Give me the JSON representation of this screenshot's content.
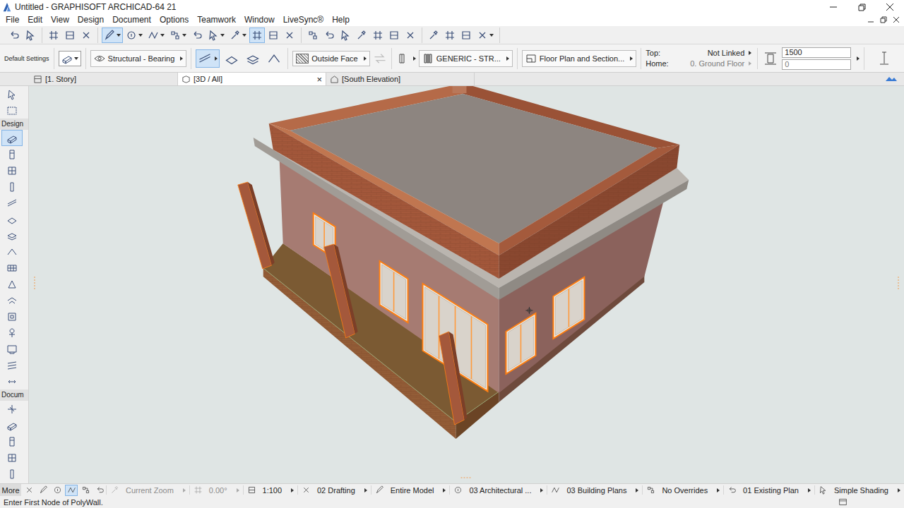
{
  "window": {
    "title": "Untitled - GRAPHISOFT ARCHICAD-64 21"
  },
  "menu": [
    "File",
    "Edit",
    "View",
    "Design",
    "Document",
    "Options",
    "Teamwork",
    "Window",
    "LiveSync®",
    "Help"
  ],
  "toolbar": [
    [
      {
        "kind": "button",
        "selected": false
      },
      {
        "kind": "button",
        "selected": false
      }
    ],
    [
      {
        "kind": "button",
        "selected": false
      },
      {
        "kind": "button",
        "selected": false
      },
      {
        "kind": "button",
        "selected": false
      }
    ],
    [
      {
        "kind": "split",
        "selected": true
      },
      {
        "kind": "split",
        "selected": false
      },
      {
        "kind": "split",
        "selected": false
      },
      {
        "kind": "split",
        "selected": false
      },
      {
        "kind": "button",
        "selected": false
      },
      {
        "kind": "split",
        "selected": false
      },
      {
        "kind": "split",
        "selected": false
      },
      {
        "kind": "button",
        "selected": true
      },
      {
        "kind": "button",
        "selected": false
      },
      {
        "kind": "button",
        "selected": false
      }
    ],
    [
      {
        "kind": "button",
        "selected": false
      },
      {
        "kind": "button",
        "selected": false
      },
      {
        "kind": "button",
        "selected": false
      },
      {
        "kind": "button",
        "selected": false
      },
      {
        "kind": "button",
        "selected": false
      },
      {
        "kind": "button",
        "selected": false
      },
      {
        "kind": "button",
        "selected": false
      }
    ],
    [
      {
        "kind": "button",
        "selected": false
      },
      {
        "kind": "button",
        "selected": false
      },
      {
        "kind": "button",
        "selected": false
      },
      {
        "kind": "split",
        "selected": false
      }
    ]
  ],
  "info_box": {
    "settings_label": "Default Settings",
    "layer": "Structural - Bearing",
    "geometry_methods": [
      {
        "selected": true
      },
      {
        "selected": false
      },
      {
        "selected": false
      },
      {
        "selected": false
      }
    ],
    "reference_line": "Outside Face",
    "composite": "GENERIC - STR...",
    "view": "Floor Plan and Section...",
    "top_label": "Top:",
    "top_value": "Not Linked",
    "home_label": "Home:",
    "home_value": "0. Ground Floor",
    "height": "1500",
    "offset": "0"
  },
  "tabs": [
    {
      "label": "[1. Story]",
      "selected": false
    },
    {
      "label": "[3D / All]",
      "selected": true,
      "close": "×"
    },
    {
      "label": "[South Elevation]",
      "selected": false
    }
  ],
  "toolbox": {
    "top_tools": [
      {
        "selected": false
      },
      {
        "selected": false
      }
    ],
    "sections": [
      {
        "label": "Design",
        "tools": [
          {
            "selected": true
          },
          {
            "selected": false
          },
          {
            "selected": false
          },
          {
            "selected": false
          },
          {
            "selected": false
          },
          {
            "selected": false
          },
          {
            "selected": false
          },
          {
            "selected": false
          },
          {
            "selected": false
          },
          {
            "selected": false
          },
          {
            "selected": false
          },
          {
            "selected": false
          },
          {
            "selected": false
          },
          {
            "selected": false
          },
          {
            "selected": false
          },
          {
            "selected": false
          }
        ]
      },
      {
        "label": "Docum",
        "tools": [
          {
            "selected": false
          },
          {
            "selected": false
          },
          {
            "selected": false
          },
          {
            "selected": false
          },
          {
            "selected": false
          }
        ]
      }
    ]
  },
  "model": {
    "windows": [
      {
        "kind": "window",
        "selected": true
      },
      {
        "kind": "window",
        "selected": true
      },
      {
        "kind": "door",
        "selected": true
      },
      {
        "kind": "window",
        "selected": true
      },
      {
        "kind": "window",
        "selected": true
      }
    ]
  },
  "bottom_bar": {
    "more": "More",
    "nav_tools": [
      {
        "selected": false
      },
      {
        "selected": false
      },
      {
        "selected": false
      },
      {
        "selected": true
      },
      {
        "selected": false
      },
      {
        "selected": false
      }
    ],
    "items": [
      {
        "label": "Current Zoom",
        "disabled": true
      },
      {
        "label": "0.00°",
        "disabled": true
      },
      {
        "label": "1:100",
        "disabled": false
      },
      {
        "label": "02 Drafting",
        "disabled": false
      },
      {
        "label": "Entire Model",
        "disabled": false
      },
      {
        "label": "03 Architectural ...",
        "disabled": false
      },
      {
        "label": "03 Building Plans",
        "disabled": false
      },
      {
        "label": "No Overrides",
        "disabled": false
      },
      {
        "label": "01 Existing Plan",
        "disabled": false
      },
      {
        "label": "Simple Shading",
        "disabled": false
      }
    ]
  },
  "status": "Enter First Node of PolyWall."
}
